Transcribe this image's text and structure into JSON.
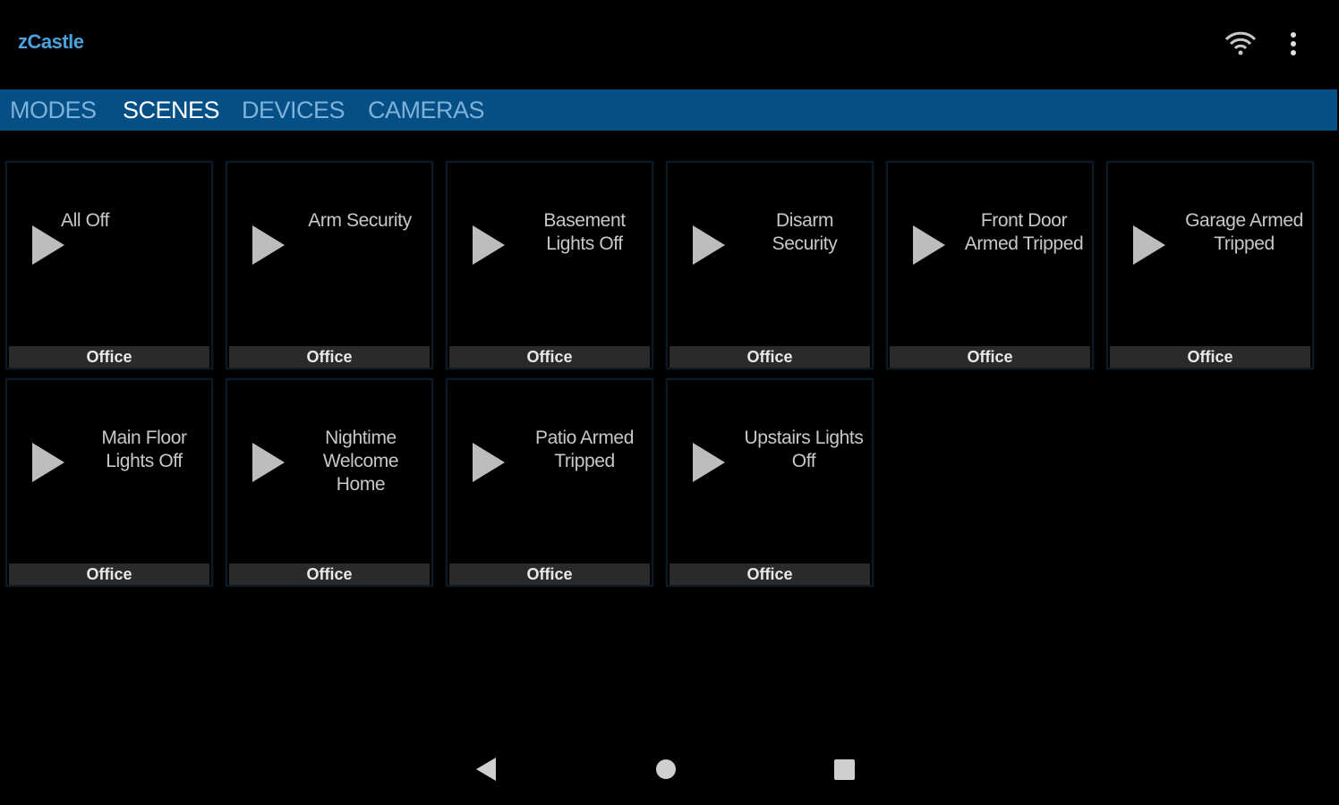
{
  "app_bar": {
    "title": "zCastle",
    "wifi_icon": "wifi-icon",
    "overflow_icon": "more-vert-icon"
  },
  "tabs": [
    {
      "label": "MODES",
      "active": false
    },
    {
      "label": "SCENES",
      "active": true
    },
    {
      "label": "DEVICES",
      "active": false
    },
    {
      "label": "CAMERAS",
      "active": false
    }
  ],
  "scenes": [
    {
      "name": "All Off",
      "room": "Office"
    },
    {
      "name": "Arm Security",
      "room": "Office"
    },
    {
      "name": "Basement Lights Off",
      "room": "Office"
    },
    {
      "name": "Disarm Security",
      "room": "Office"
    },
    {
      "name": "Front Door Armed Tripped",
      "room": "Office"
    },
    {
      "name": "Garage Armed Tripped",
      "room": "Office"
    },
    {
      "name": "Main Floor Lights Off",
      "room": "Office"
    },
    {
      "name": "Nightime Welcome Home",
      "room": "Office"
    },
    {
      "name": "Patio Armed Tripped",
      "room": "Office"
    },
    {
      "name": "Upstairs Lights Off",
      "room": "Office"
    }
  ],
  "nav": {
    "back_icon": "back-triangle-icon",
    "home_icon": "home-circle-icon",
    "recents_icon": "recents-square-icon"
  },
  "colors": {
    "accent": "#4aa3df",
    "tab_bar": "#034f86",
    "tab_inactive": "#7fb2d8",
    "tab_active": "#ffffff",
    "play_icon": "#bdbdbd",
    "room_label_bg": "#2a2a2a"
  }
}
